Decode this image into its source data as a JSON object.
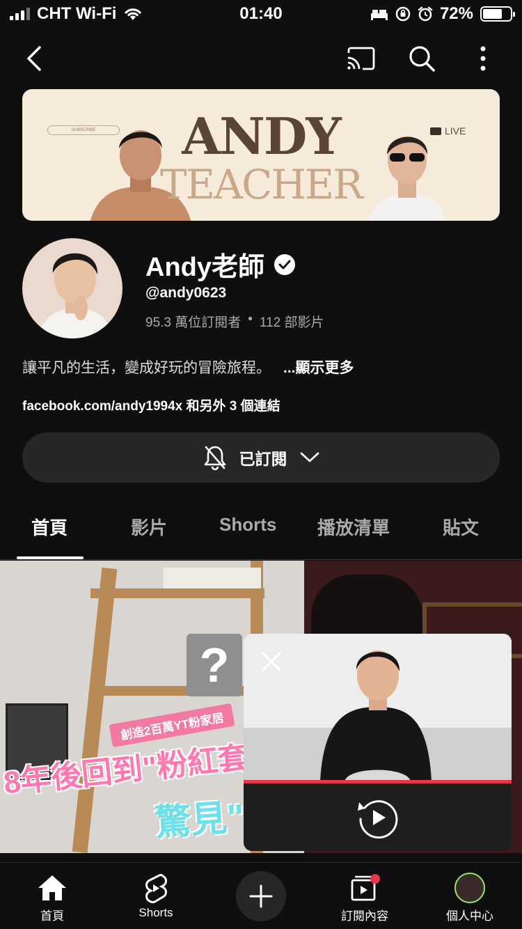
{
  "status_bar": {
    "carrier": "CHT Wi-Fi",
    "time": "01:40",
    "battery": "72%",
    "battery_level": 0.72
  },
  "banner": {
    "title": "ANDY",
    "subtitle": "TEACHER",
    "pill_text": "SUBSCRIBE",
    "live_label": "LIVE"
  },
  "channel": {
    "name": "Andy老師",
    "handle": "@andy0623",
    "subscribers": "95.3 萬位訂閱者",
    "separator": "•",
    "videos": "112 部影片",
    "description": "讓平凡的生活，變成好玩的冒險旅程。",
    "show_more": "...顯示更多",
    "links": "facebook.com/andy1994x 和另外 3 個連結"
  },
  "subscribe": {
    "label": "已訂閱"
  },
  "tabs": [
    "首頁",
    "影片",
    "Shorts",
    "播放清單",
    "貼文"
  ],
  "video": {
    "tag": "創造2百萬YT粉家居",
    "headline1": "8年後回到\"粉紅套",
    "headline2": "驚見\"",
    "question": "?"
  },
  "bottom_nav": {
    "home": "首頁",
    "shorts": "Shorts",
    "subscriptions": "訂閱內容",
    "me": "個人中心"
  },
  "colors": {
    "background": "#0f0f0f",
    "accent_red": "#e3394a",
    "chip": "#272727"
  }
}
